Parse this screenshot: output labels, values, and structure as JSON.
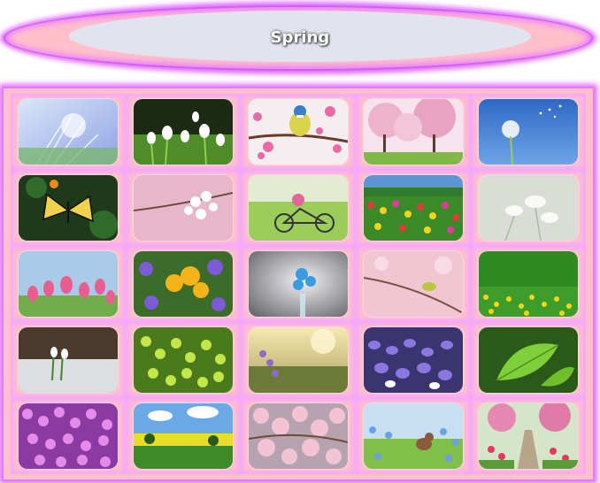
{
  "header": {
    "title": "Spring"
  },
  "gallery": {
    "items": [
      {
        "name": "dandelion-seeds-thumbnail"
      },
      {
        "name": "snowdrops-thumbnail"
      },
      {
        "name": "blue-tit-blossom-thumbnail"
      },
      {
        "name": "pink-trees-park-thumbnail"
      },
      {
        "name": "dandelion-sky-thumbnail"
      },
      {
        "name": "butterfly-thumbnail"
      },
      {
        "name": "cherry-blossom-branch-thumbnail"
      },
      {
        "name": "bicycle-meadow-thumbnail"
      },
      {
        "name": "tulip-field-thumbnail"
      },
      {
        "name": "white-flowers-thumbnail"
      },
      {
        "name": "pink-tulips-thumbnail"
      },
      {
        "name": "crocus-mix-thumbnail"
      },
      {
        "name": "blue-flower-vase-thumbnail"
      },
      {
        "name": "bird-branch-thumbnail"
      },
      {
        "name": "yellow-meadow-thumbnail"
      },
      {
        "name": "snowdrops-snow-thumbnail"
      },
      {
        "name": "green-leaves-thumbnail"
      },
      {
        "name": "sunset-grass-thumbnail"
      },
      {
        "name": "purple-crocus-field-thumbnail"
      },
      {
        "name": "leaf-dew-thumbnail"
      },
      {
        "name": "pink-phlox-thumbnail"
      },
      {
        "name": "rapeseed-landscape-thumbnail"
      },
      {
        "name": "cherry-blossoms-thumbnail"
      },
      {
        "name": "chipmunk-flowers-thumbnail"
      },
      {
        "name": "garden-path-thumbnail"
      }
    ]
  }
}
